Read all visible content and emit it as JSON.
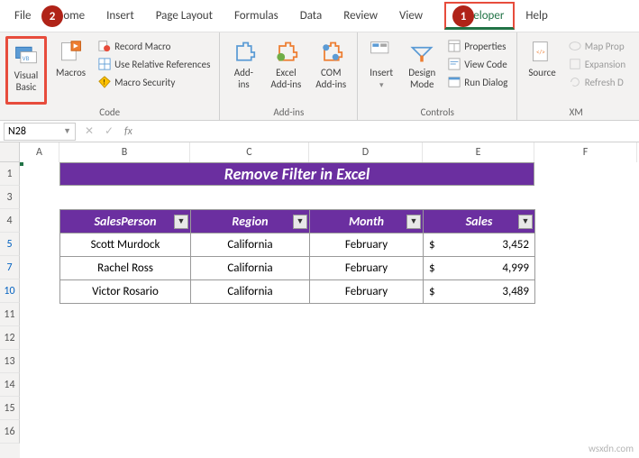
{
  "tabs": {
    "file": "File",
    "home": "ome",
    "insert": "Insert",
    "page_layout": "Page Layout",
    "formulas": "Formulas",
    "data": "Data",
    "review": "Review",
    "view": "View",
    "developer": "Developer",
    "help": "Help"
  },
  "callouts": {
    "one": "1",
    "two": "2"
  },
  "ribbon": {
    "code": {
      "visual_basic": "Visual\nBasic",
      "macros": "Macros",
      "record": "Record Macro",
      "relative": "Use Relative References",
      "security": "Macro Security",
      "label": "Code"
    },
    "addins": {
      "addins": "Add-\nins",
      "excel": "Excel\nAdd-ins",
      "com": "COM\nAdd-ins",
      "label": "Add-ins"
    },
    "controls": {
      "insert": "Insert",
      "design": "Design\nMode",
      "properties": "Properties",
      "view_code": "View Code",
      "run_dialog": "Run Dialog",
      "label": "Controls"
    },
    "xml": {
      "source": "Source",
      "map_props": "Map Prop",
      "expansion": "Expansion",
      "refresh": "Refresh D",
      "label": "XM"
    }
  },
  "formula": {
    "name_box": "N28",
    "fx": "fx"
  },
  "cols": {
    "A": "A",
    "B": "B",
    "C": "C",
    "D": "D",
    "E": "E",
    "F": "F"
  },
  "rows": [
    "1",
    "3",
    "4",
    "5",
    "7",
    "10",
    "11",
    "12",
    "13",
    "14",
    "15",
    "16"
  ],
  "title": "Remove Filter in Excel",
  "table": {
    "headers": [
      "SalesPerson",
      "Region",
      "Month",
      "Sales"
    ],
    "rows": [
      {
        "person": "Scott Murdock",
        "region": "California",
        "month": "February",
        "sales_sym": "$",
        "sales": "3,452"
      },
      {
        "person": "Rachel Ross",
        "region": "California",
        "month": "February",
        "sales_sym": "$",
        "sales": "4,999"
      },
      {
        "person": "Victor Rosario",
        "region": "California",
        "month": "February",
        "sales_sym": "$",
        "sales": "3,489"
      }
    ]
  },
  "chart_data": {
    "type": "table",
    "title": "Remove Filter in Excel",
    "columns": [
      "SalesPerson",
      "Region",
      "Month",
      "Sales"
    ],
    "rows": [
      [
        "Scott Murdock",
        "California",
        "February",
        3452
      ],
      [
        "Rachel Ross",
        "California",
        "February",
        4999
      ],
      [
        "Victor Rosario",
        "California",
        "February",
        3489
      ]
    ]
  },
  "watermark": "wsxdn.com"
}
